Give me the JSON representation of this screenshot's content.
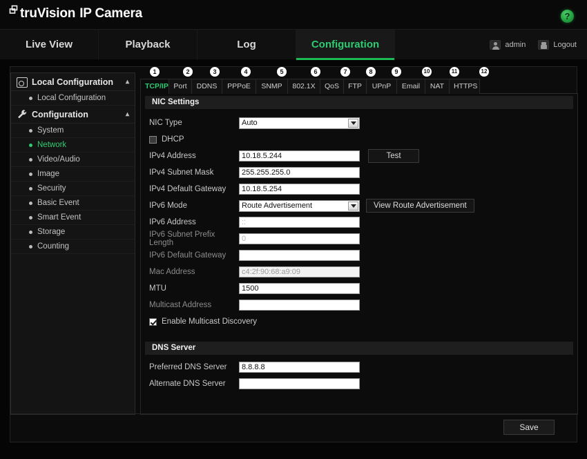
{
  "brand": {
    "logo_icon": "camera-layers-icon",
    "name": "truVision",
    "product": "IP Camera",
    "help_label": "?"
  },
  "topnav": {
    "tabs": [
      {
        "label": "Live View",
        "active": false
      },
      {
        "label": "Playback",
        "active": false
      },
      {
        "label": "Log",
        "active": false
      },
      {
        "label": "Configuration",
        "active": true
      }
    ],
    "user": "admin",
    "logout": "Logout",
    "accent_color": "#2ecc71"
  },
  "sidebar": {
    "groups": [
      {
        "title": "Local Configuration",
        "icon": "camera-icon",
        "expanded": true,
        "items": [
          {
            "label": "Local Configuration",
            "selected": false
          }
        ]
      },
      {
        "title": "Configuration",
        "icon": "wrench-icon",
        "expanded": true,
        "items": [
          {
            "label": "System",
            "selected": false
          },
          {
            "label": "Network",
            "selected": true
          },
          {
            "label": "Video/Audio",
            "selected": false
          },
          {
            "label": "Image",
            "selected": false
          },
          {
            "label": "Security",
            "selected": false
          },
          {
            "label": "Basic Event",
            "selected": false
          },
          {
            "label": "Smart Event",
            "selected": false
          },
          {
            "label": "Storage",
            "selected": false
          },
          {
            "label": "Counting",
            "selected": false
          }
        ]
      }
    ]
  },
  "subtabs": [
    {
      "badge": "1",
      "label": "TCP/IP",
      "active": true
    },
    {
      "badge": "2",
      "label": "Port",
      "active": false
    },
    {
      "badge": "3",
      "label": "DDNS",
      "active": false
    },
    {
      "badge": "4",
      "label": "PPPoE",
      "active": false
    },
    {
      "badge": "5",
      "label": "SNMP",
      "active": false
    },
    {
      "badge": "6",
      "label": "802.1X",
      "active": false
    },
    {
      "badge": "7",
      "label": "QoS",
      "active": false
    },
    {
      "badge": "8",
      "label": "FTP",
      "active": false
    },
    {
      "badge": "9",
      "label": "UPnP",
      "active": false
    },
    {
      "badge": "10",
      "label": "Email",
      "active": false
    },
    {
      "badge": "11",
      "label": "NAT",
      "active": false
    },
    {
      "badge": "12",
      "label": "HTTPS",
      "active": false
    }
  ],
  "nic": {
    "section_title": "NIC Settings",
    "nic_type_label": "NIC Type",
    "nic_type_value": "Auto",
    "dhcp_label": "DHCP",
    "dhcp_checked": false,
    "ipv4_address_label": "IPv4 Address",
    "ipv4_address_value": "10.18.5.244",
    "test_button": "Test",
    "ipv4_subnet_label": "IPv4 Subnet Mask",
    "ipv4_subnet_value": "255.255.255.0",
    "ipv4_gateway_label": "IPv4 Default Gateway",
    "ipv4_gateway_value": "10.18.5.254",
    "ipv6_mode_label": "IPv6 Mode",
    "ipv6_mode_value": "Route Advertisement",
    "view_route_button": "View Route Advertisement",
    "ipv6_address_label": "IPv6 Address",
    "ipv6_address_value": "::",
    "ipv6_prefix_label": "IPv6 Subnet Prefix Length",
    "ipv6_prefix_value": "0",
    "ipv6_gateway_label": "IPv6 Default Gateway",
    "ipv6_gateway_value": "",
    "mac_label": "Mac Address",
    "mac_value": "c4:2f:90:68:a9:09",
    "mtu_label": "MTU",
    "mtu_value": "1500",
    "multicast_label": "Multicast Address",
    "multicast_value": "",
    "enable_multicast_label": "Enable Multicast Discovery",
    "enable_multicast_checked": true
  },
  "dns": {
    "section_title": "DNS Server",
    "preferred_label": "Preferred DNS Server",
    "preferred_value": "8.8.8.8",
    "alternate_label": "Alternate DNS Server",
    "alternate_value": ""
  },
  "footer": {
    "save_label": "Save"
  }
}
